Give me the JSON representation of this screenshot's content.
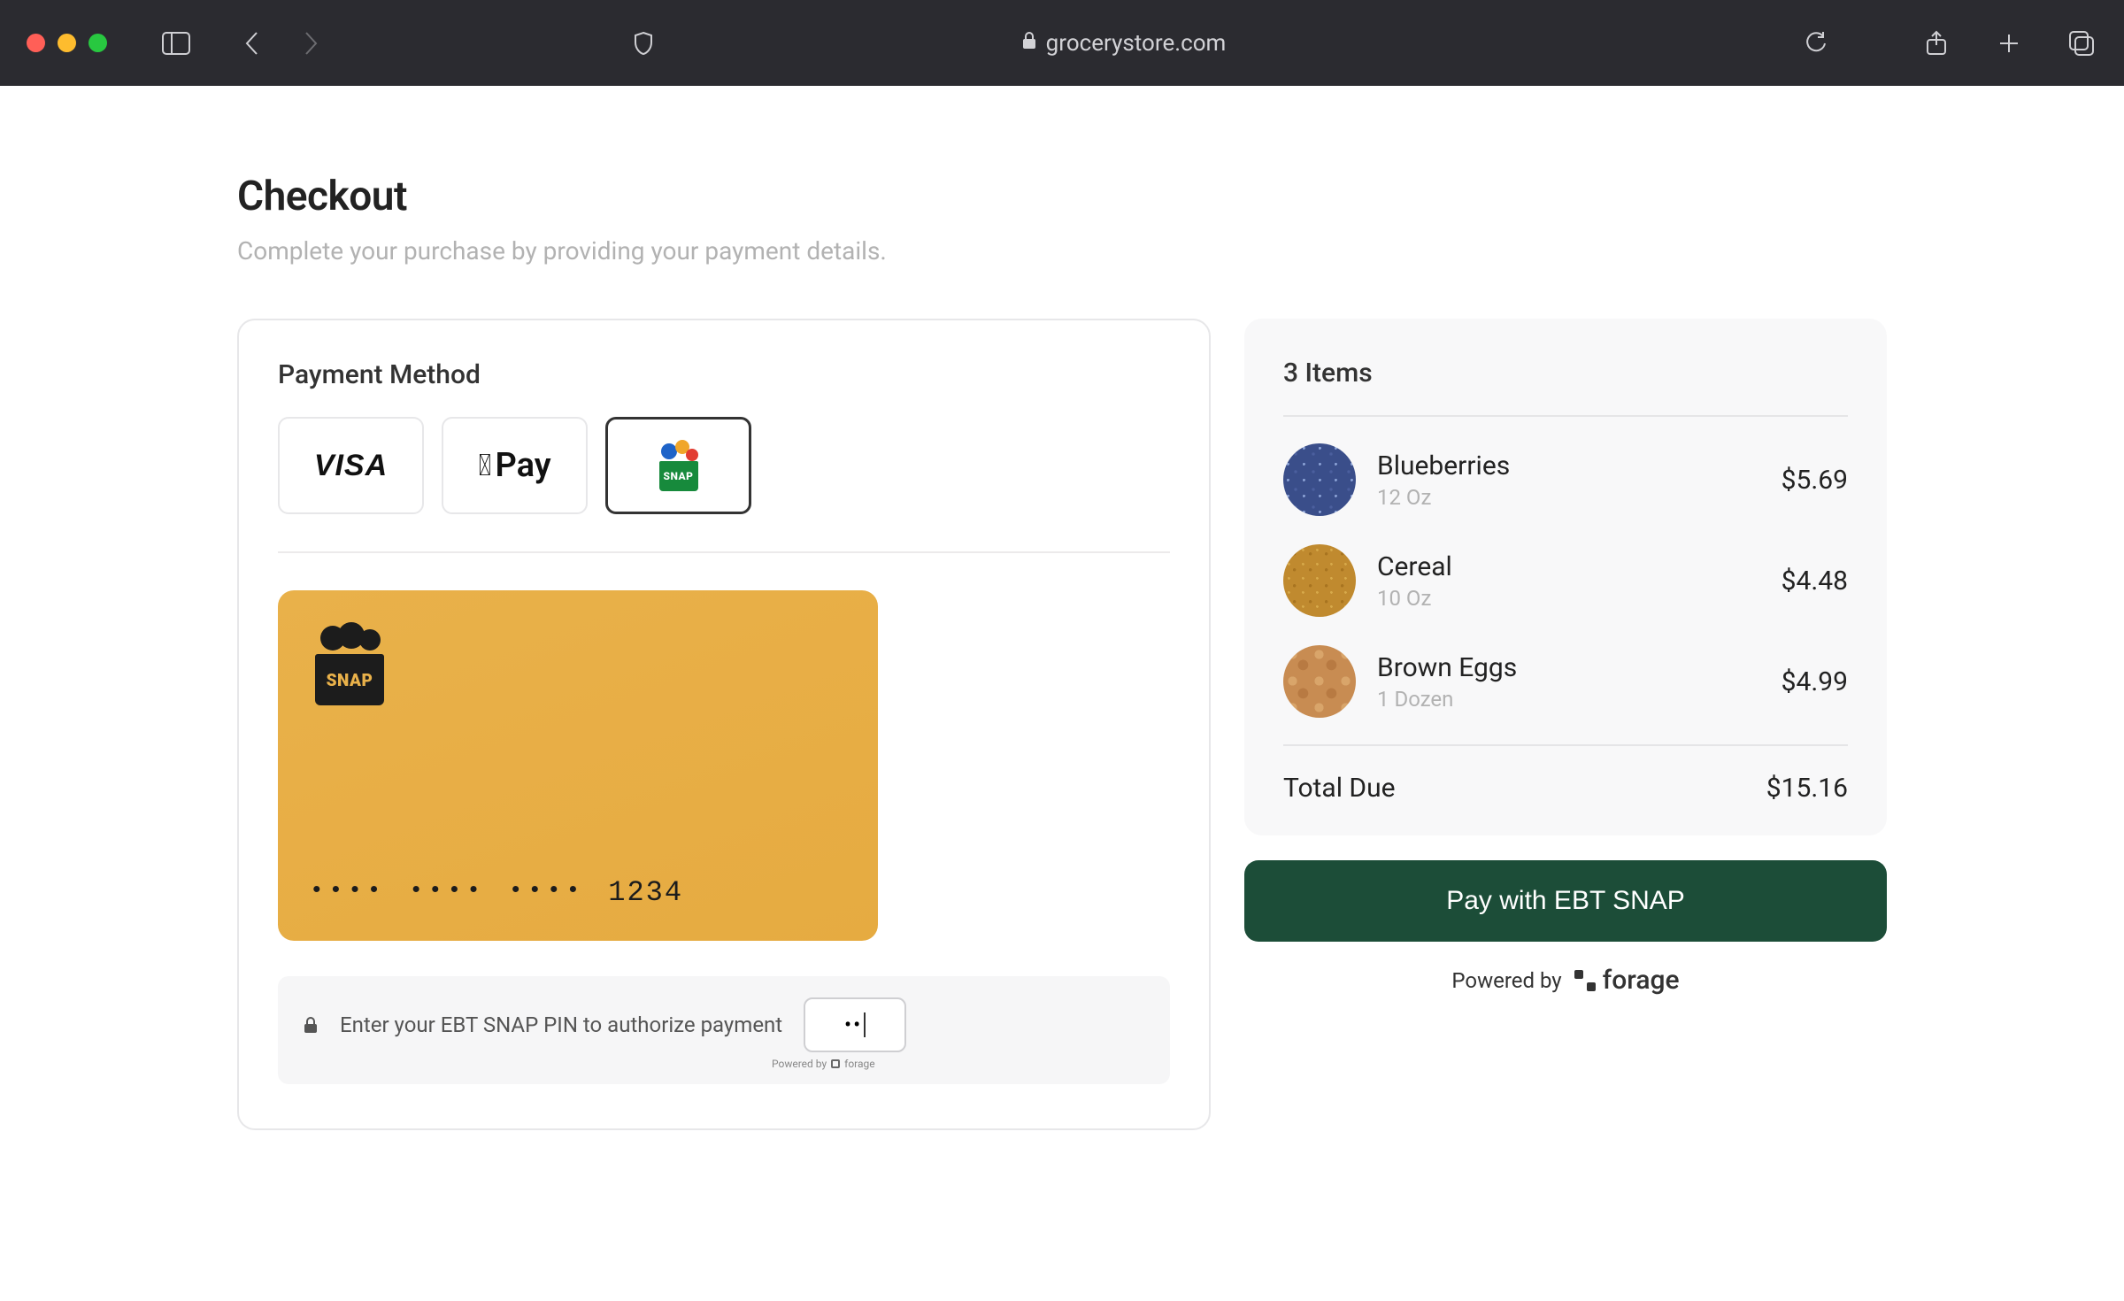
{
  "browser": {
    "url_display": "grocerystore.com"
  },
  "page": {
    "title": "Checkout",
    "subtitle": "Complete your purchase by providing your payment details."
  },
  "payment": {
    "section_title": "Payment Method",
    "methods": [
      {
        "id": "visa",
        "label": "VISA",
        "selected": false
      },
      {
        "id": "applepay",
        "label": "Pay",
        "selected": false
      },
      {
        "id": "snap",
        "label": "SNAP",
        "selected": true
      }
    ],
    "card": {
      "brand": "SNAP",
      "masked_groups": [
        "••••",
        "••••",
        "••••"
      ],
      "last4": "1234"
    },
    "pin": {
      "prompt": "Enter your EBT SNAP PIN to authorize payment",
      "value_masked": "••",
      "powered_by_mini": "Powered by",
      "powered_brand_mini": "forage"
    }
  },
  "order": {
    "count_label": "3 Items",
    "items": [
      {
        "name": "Blueberries",
        "sub": "12 Oz",
        "price": "$5.69",
        "thumb": "blue"
      },
      {
        "name": "Cereal",
        "sub": "10 Oz",
        "price": "$4.48",
        "thumb": "cereal"
      },
      {
        "name": "Brown Eggs",
        "sub": "1 Dozen",
        "price": "$4.99",
        "thumb": "eggs"
      }
    ],
    "total_label": "Total Due",
    "total_value": "$15.16"
  },
  "cta": {
    "pay_label": "Pay with EBT SNAP",
    "powered_by": "Powered by",
    "powered_brand": "forage"
  }
}
